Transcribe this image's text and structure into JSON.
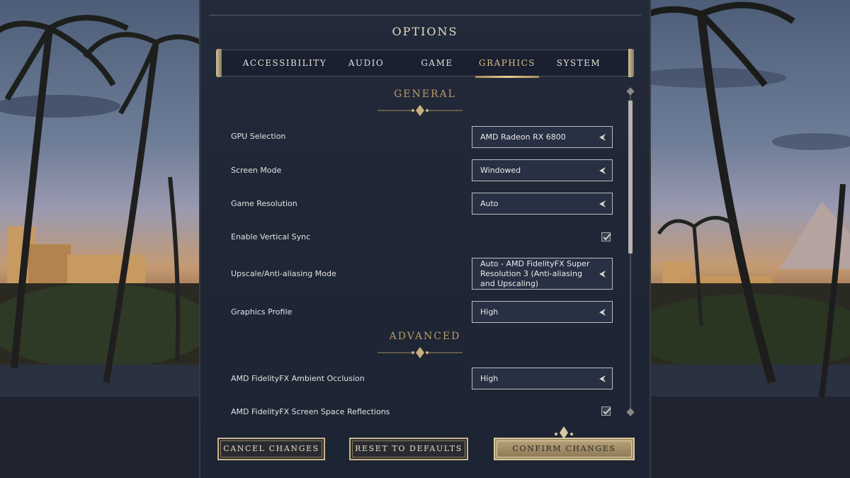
{
  "title": "OPTIONS",
  "tabs": [
    {
      "label": "ACCESSIBILITY",
      "active": false
    },
    {
      "label": "AUDIO",
      "active": false
    },
    {
      "label": "GAME",
      "active": false
    },
    {
      "label": "GRAPHICS",
      "active": true
    },
    {
      "label": "SYSTEM",
      "active": false
    }
  ],
  "sections": {
    "general": "GENERAL",
    "advanced": "ADVANCED"
  },
  "settings": {
    "gpu": {
      "label": "GPU Selection",
      "value": "AMD Radeon RX 6800"
    },
    "screen_mode": {
      "label": "Screen Mode",
      "value": "Windowed"
    },
    "resolution": {
      "label": "Game Resolution",
      "value": "Auto"
    },
    "vsync": {
      "label": "Enable Vertical Sync",
      "checked": true
    },
    "upscale": {
      "label": "Upscale/Anti-aliasing Mode",
      "value": "Auto - AMD FidelityFX Super Resolution 3 (Anti-aliasing and Upscaling)"
    },
    "profile": {
      "label": "Graphics Profile",
      "value": "High"
    },
    "ambient_occlusion": {
      "label": "AMD FidelityFX Ambient Occlusion",
      "value": "High"
    },
    "ssr": {
      "label": "AMD FidelityFX Screen Space Reflections",
      "checked": true
    }
  },
  "buttons": {
    "cancel": "CANCEL CHANGES",
    "reset": "RESET TO DEFAULTS",
    "confirm": "CONFIRM CHANGES"
  },
  "colors": {
    "accent_gold": "#c8b58a",
    "panel_bg": "#1f2635",
    "active_tab": "#d8bf8a"
  }
}
